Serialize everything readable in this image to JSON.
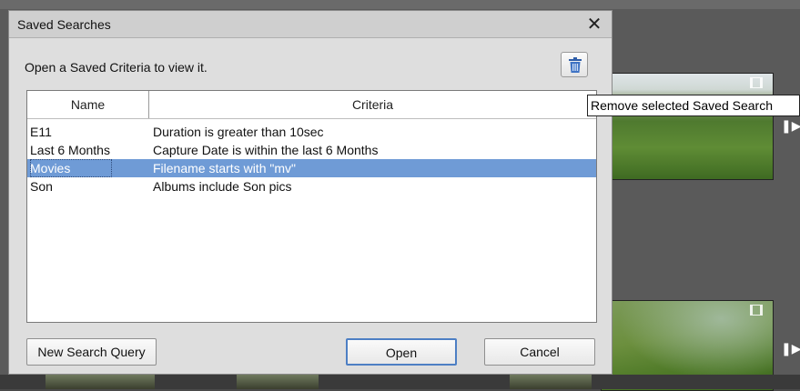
{
  "dialog": {
    "title": "Saved Searches",
    "close_icon": "close-icon",
    "instruction": "Open a Saved Criteria to view it.",
    "trash_icon": "trash-icon"
  },
  "tooltip": "Remove selected Saved Search",
  "list": {
    "columns": {
      "name": "Name",
      "criteria": "Criteria"
    },
    "rows": [
      {
        "name": "E11",
        "criteria": "Duration is greater than 10sec",
        "selected": false
      },
      {
        "name": "Last 6 Months",
        "criteria": "Capture Date is within the last 6 Months",
        "selected": false
      },
      {
        "name": "Movies",
        "criteria": "Filename starts with \"mv\"",
        "selected": true
      },
      {
        "name": "Son",
        "criteria": "Albums include Son pics",
        "selected": false
      }
    ]
  },
  "buttons": {
    "new_query": "New Search Query",
    "open": "Open",
    "cancel": "Cancel"
  },
  "colors": {
    "selection": "#6f9bd6",
    "dialog_bg": "#dedede",
    "default_button_border": "#4d7fc4"
  }
}
